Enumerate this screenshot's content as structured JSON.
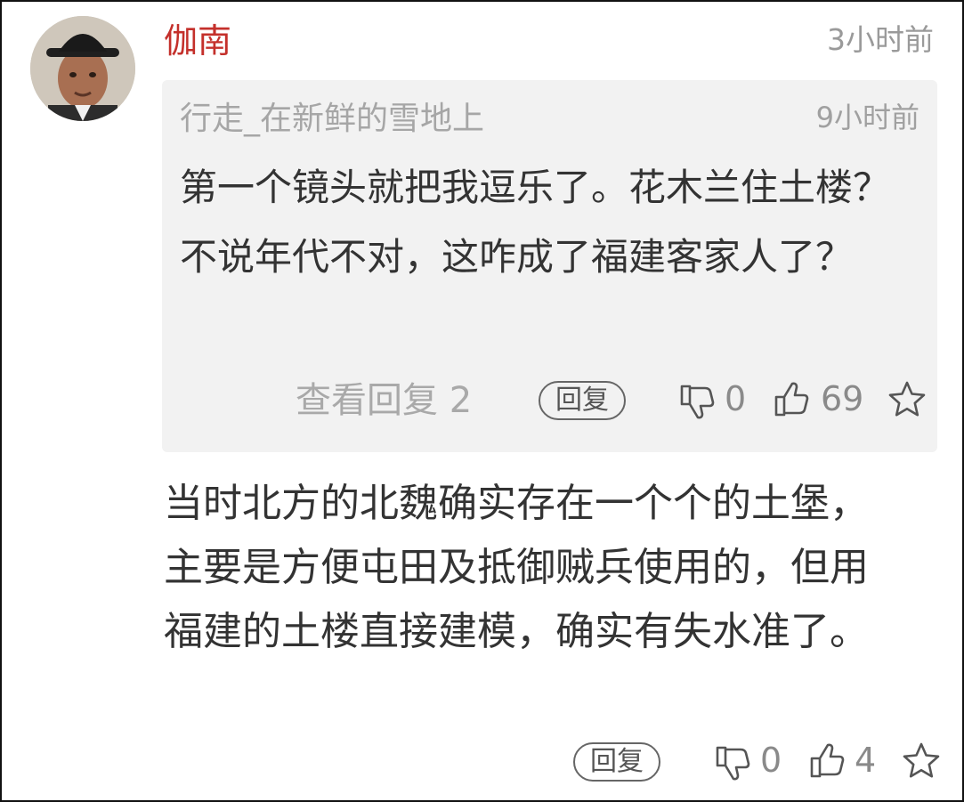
{
  "comment": {
    "username": "伽南",
    "time": "3小时前",
    "quoted": {
      "username": "行走_在新鲜的雪地上",
      "time": "9小时前",
      "text": "第一个镜头就把我逗乐了。花木兰住土楼？不说年代不对，这咋成了福建客家人了？",
      "view_replies": "查看回复 2",
      "reply_label": "回复",
      "dislike_count": "0",
      "like_count": "69"
    },
    "text": "当时北方的北魏确实存在一个个的土堡，主要是方便屯田及抵御贼兵使用的，但用福建的土楼直接建模，确实有失水准了。",
    "reply_label": "回复",
    "dislike_count": "0",
    "like_count": "4"
  },
  "colors": {
    "username": "#c4302b",
    "quote_background": "#f2f2f2",
    "text": "#333333",
    "meta": "#9a9a9a"
  },
  "icons": [
    "avatar-image",
    "thumb-down-icon",
    "thumb-up-icon",
    "star-icon"
  ]
}
